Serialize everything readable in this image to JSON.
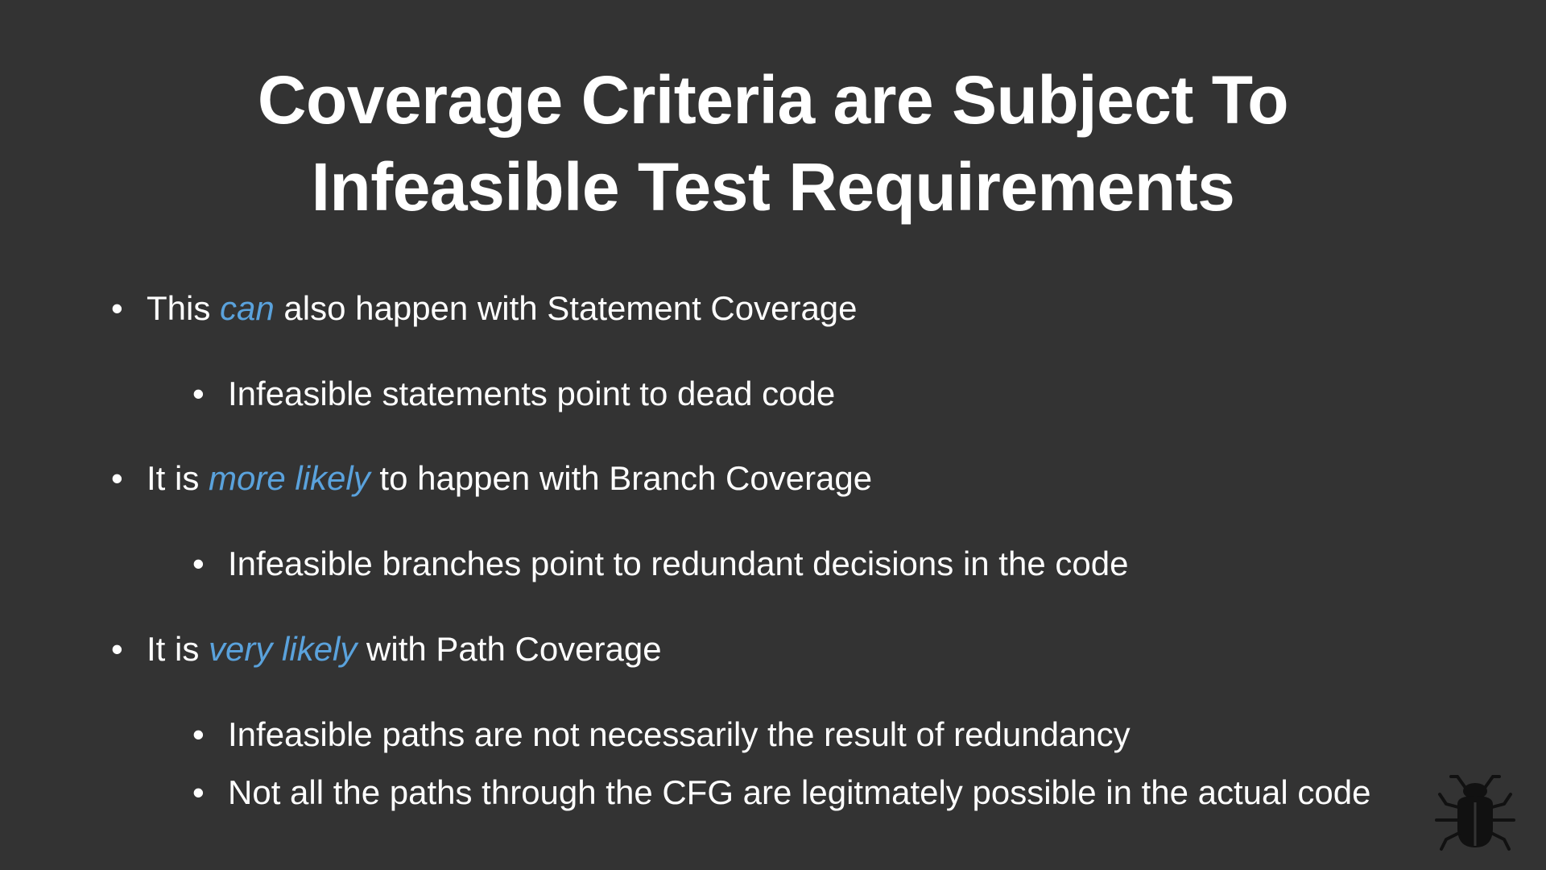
{
  "slide": {
    "title_line1": "Coverage Criteria are Subject To",
    "title_line2": "Infeasible Test Requirements",
    "bullets": [
      {
        "pre": "This ",
        "em": "can",
        "post": " also happen with Statement Coverage"
      },
      {
        "text": "Infeasible statements point to dead code"
      },
      {
        "pre": "It is ",
        "em": "more likely",
        "post": " to happen with Branch Coverage"
      },
      {
        "text": "Infeasible branches point to redundant decisions in the code"
      },
      {
        "pre": "It is ",
        "em": "very likely",
        "post": " with Path Coverage"
      },
      {
        "text": "Infeasible paths are not necessarily the result of redundancy"
      },
      {
        "text": "Not all the paths through the CFG are legitmately possible in the actual code"
      }
    ],
    "bullet_glyph": "•",
    "logo_icon": "bug-icon",
    "colors": {
      "background": "#333333",
      "text": "#ffffff",
      "emphasis": "#5aa2dc",
      "logo": "#111111"
    }
  }
}
